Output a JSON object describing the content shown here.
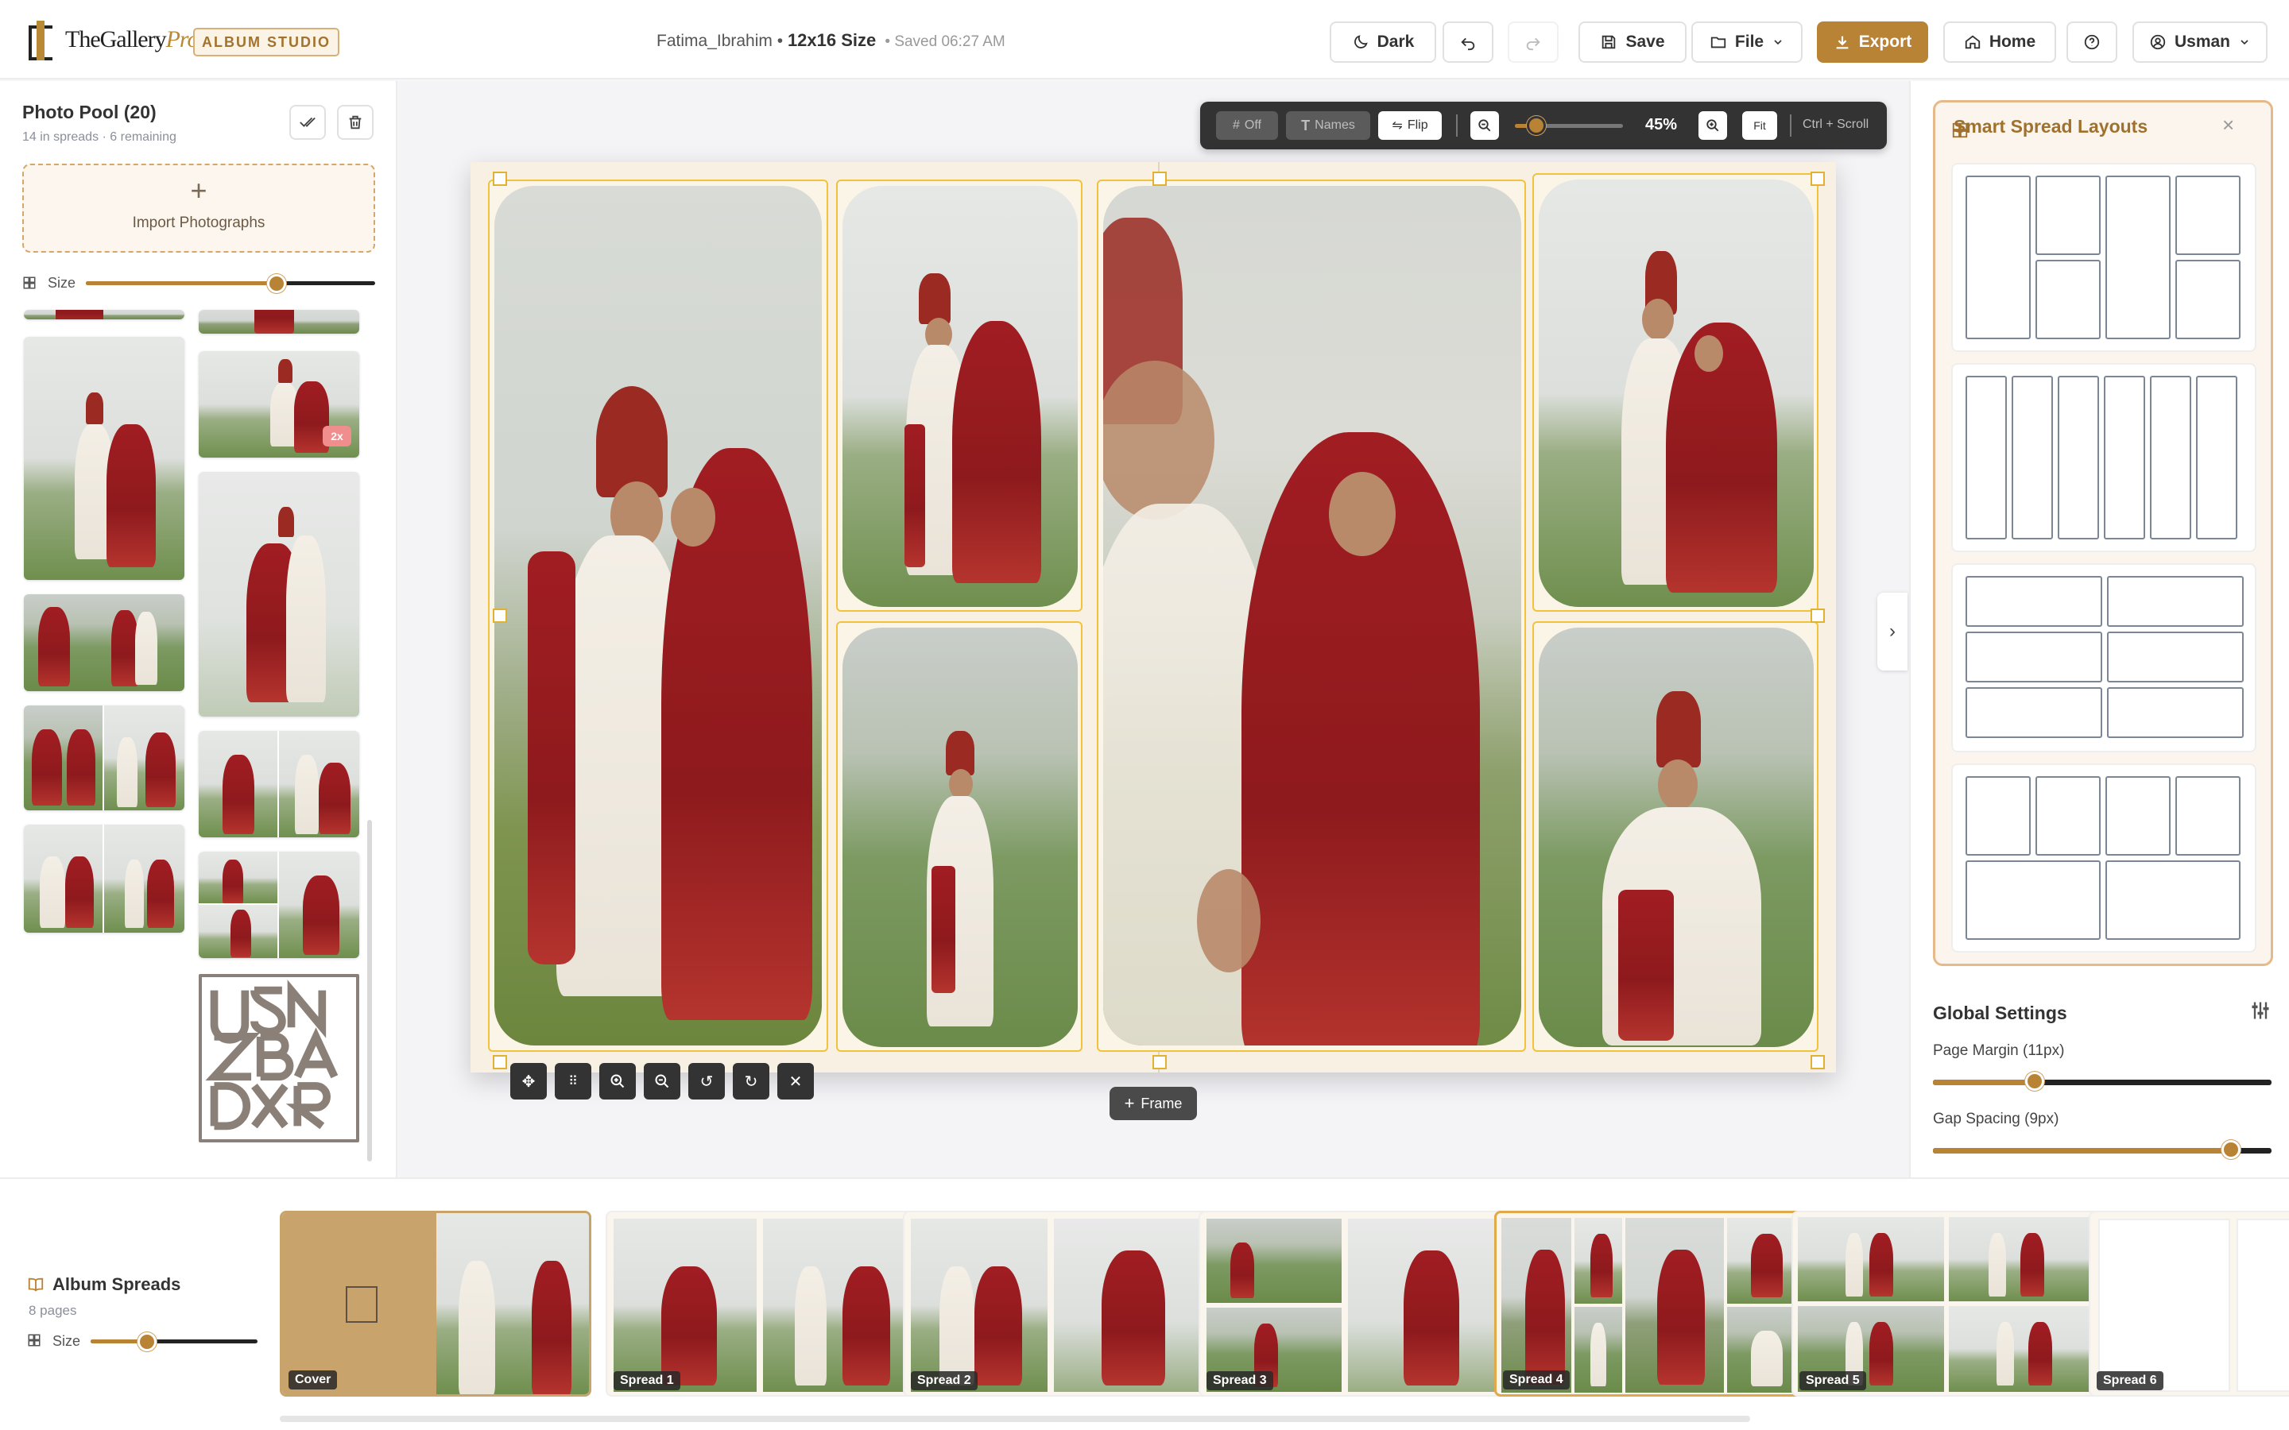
{
  "header": {
    "brand_name": "TheGallery",
    "brand_suffix": "Pro",
    "studio_badge": "ALBUM STUDIO",
    "doc_name": "Fatima_Ibrahim",
    "doc_sep": "•",
    "doc_size": "12x16 Size",
    "saved_status": "Saved 06:27 AM",
    "buttons": {
      "dark": "Dark",
      "save": "Save",
      "file": "File",
      "export": "Export",
      "home": "Home",
      "user": "Usman"
    }
  },
  "pool": {
    "title": "Photo Pool (20)",
    "subtitle": "14 in spreads · 6 remaining",
    "import_label": "Import Photographs",
    "size_label": "Size",
    "size_value": 0.66,
    "badge": "2x"
  },
  "toolbar": {
    "grid_label": "Off",
    "names_label": "Names",
    "flip_label": "Flip",
    "zoom_value": "45%",
    "zoom_level": 0.2,
    "fit_label": "Fit",
    "hint": "Ctrl + Scroll"
  },
  "canvas": {
    "frame_button": "Frame"
  },
  "layouts": {
    "title": "Smart Spread Layouts"
  },
  "global": {
    "title": "Global Settings",
    "margin_label": "Page Margin (11px)",
    "margin_value": 0.3,
    "gap_label": "Gap Spacing (9px)",
    "gap_value": 0.88
  },
  "spreads": {
    "title": "Album Spreads",
    "subtitle": "8 pages",
    "size_label": "Size",
    "size_value": 0.34,
    "items": [
      {
        "label": "Cover"
      },
      {
        "label": "Spread 1"
      },
      {
        "label": "Spread 2"
      },
      {
        "label": "Spread 3"
      },
      {
        "label": "Spread 4"
      },
      {
        "label": "Spread 5"
      },
      {
        "label": "Spread 6"
      }
    ]
  },
  "colors": {
    "accent": "#b98336",
    "frame_border": "#f1c23a",
    "toolbar_bg": "#333333"
  }
}
